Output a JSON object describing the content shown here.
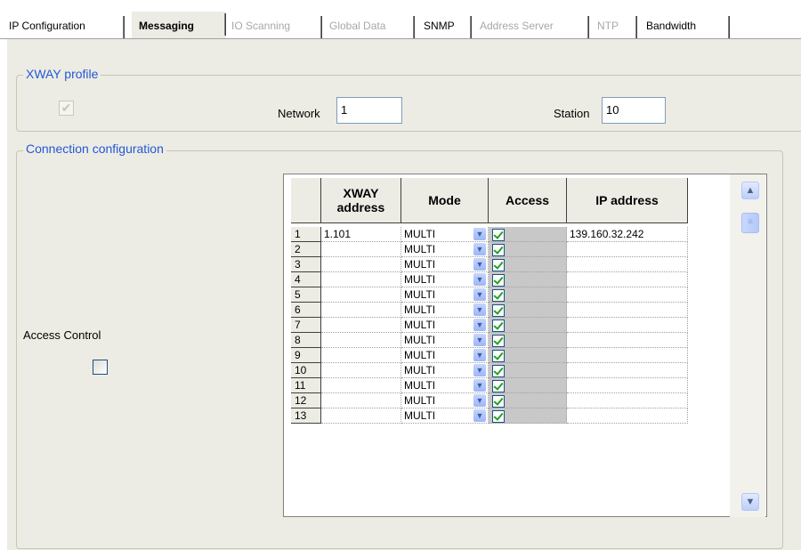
{
  "tabs": [
    {
      "label": "IP Configuration",
      "state": "normal"
    },
    {
      "label": "Messaging",
      "state": "active"
    },
    {
      "label": "IO Scanning",
      "state": "disabled"
    },
    {
      "label": "Global Data",
      "state": "disabled"
    },
    {
      "label": "SNMP",
      "state": "normal"
    },
    {
      "label": "Address Server",
      "state": "disabled"
    },
    {
      "label": "NTP",
      "state": "disabled"
    },
    {
      "label": "Bandwidth",
      "state": "normal"
    }
  ],
  "xway": {
    "title": "XWAY profile",
    "enabled_checked": true,
    "network_label": "Network",
    "network_value": "1",
    "station_label": "Station",
    "station_value": "10"
  },
  "connection": {
    "title": "Connection configuration",
    "access_control_label": "Access Control",
    "access_control_checked": false
  },
  "grid": {
    "headers": {
      "xway_line1": "XWAY",
      "xway_line2": "address",
      "mode": "Mode",
      "access": "Access",
      "ip": "IP address"
    },
    "rows": [
      {
        "n": "1",
        "xway": "1.101",
        "mode": "MULTI",
        "access": true,
        "ip": "139.160.32.242"
      },
      {
        "n": "2",
        "xway": "",
        "mode": "MULTI",
        "access": true,
        "ip": ""
      },
      {
        "n": "3",
        "xway": "",
        "mode": "MULTI",
        "access": true,
        "ip": ""
      },
      {
        "n": "4",
        "xway": "",
        "mode": "MULTI",
        "access": true,
        "ip": ""
      },
      {
        "n": "5",
        "xway": "",
        "mode": "MULTI",
        "access": true,
        "ip": ""
      },
      {
        "n": "6",
        "xway": "",
        "mode": "MULTI",
        "access": true,
        "ip": ""
      },
      {
        "n": "7",
        "xway": "",
        "mode": "MULTI",
        "access": true,
        "ip": ""
      },
      {
        "n": "8",
        "xway": "",
        "mode": "MULTI",
        "access": true,
        "ip": ""
      },
      {
        "n": "9",
        "xway": "",
        "mode": "MULTI",
        "access": true,
        "ip": ""
      },
      {
        "n": "10",
        "xway": "",
        "mode": "MULTI",
        "access": true,
        "ip": ""
      },
      {
        "n": "11",
        "xway": "",
        "mode": "MULTI",
        "access": true,
        "ip": ""
      },
      {
        "n": "12",
        "xway": "",
        "mode": "MULTI",
        "access": true,
        "ip": ""
      },
      {
        "n": "13",
        "xway": "",
        "mode": "MULTI",
        "access": true,
        "ip": ""
      }
    ]
  },
  "icons": {
    "dropdown": "chevron-down-icon",
    "scroll_up": "chevron-up-icon",
    "scroll_down": "chevron-down-icon"
  },
  "colors": {
    "group_title": "#2557d6",
    "panel_bg": "#ecece4",
    "check": "#21a121"
  }
}
